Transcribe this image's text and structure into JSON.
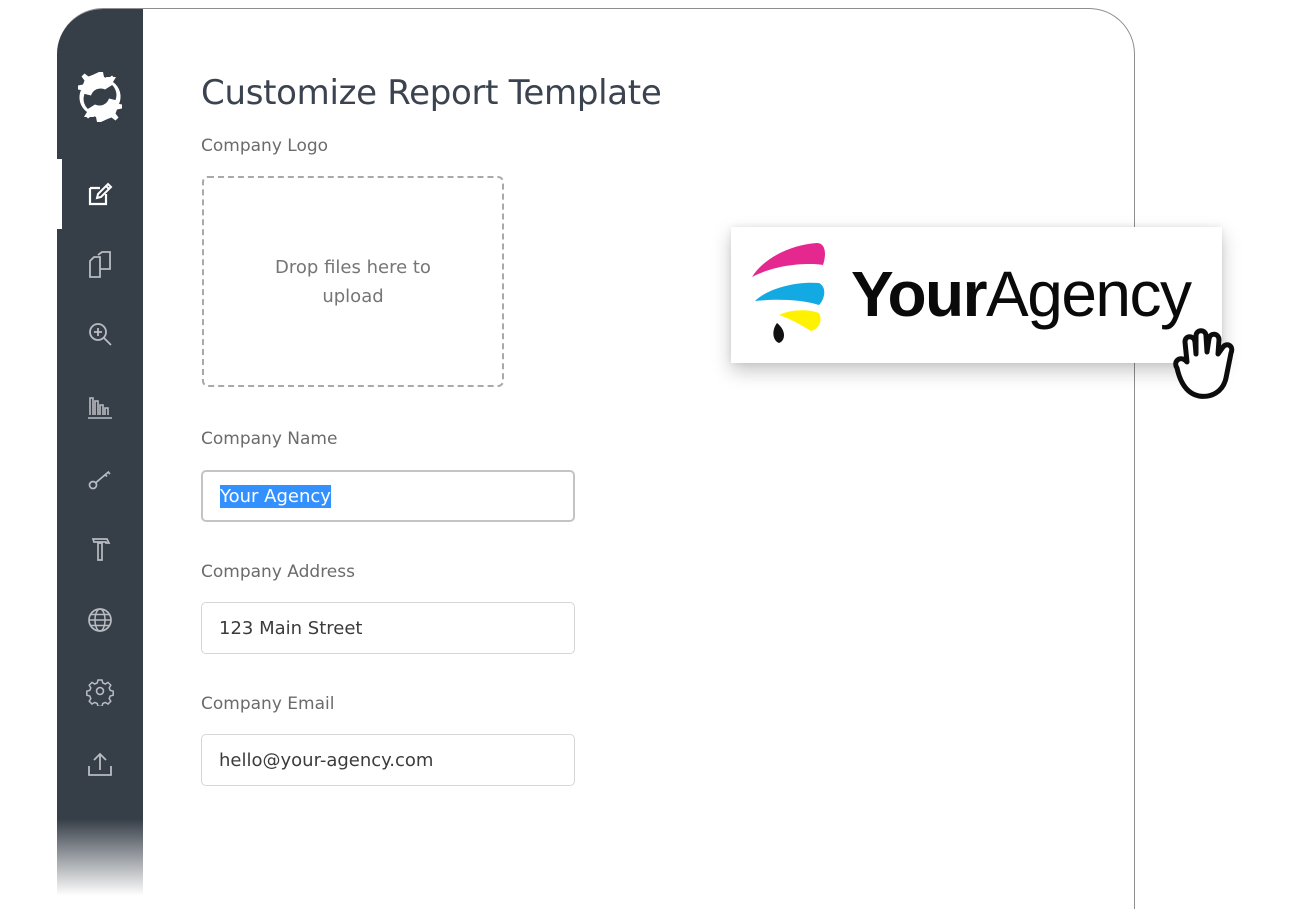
{
  "app": {
    "sidebar": {
      "logo_icon": "gear-sync-icon",
      "items": [
        {
          "id": "edit",
          "icon": "edit-icon",
          "active": true
        },
        {
          "id": "documents",
          "icon": "copy-documents-icon",
          "active": false
        },
        {
          "id": "search",
          "icon": "zoom-in-icon",
          "active": false
        },
        {
          "id": "reports",
          "icon": "bar-chart-icon",
          "active": false
        },
        {
          "id": "keys",
          "icon": "key-icon",
          "active": false
        },
        {
          "id": "tools",
          "icon": "hammer-icon",
          "active": false
        },
        {
          "id": "web",
          "icon": "globe-icon",
          "active": false
        },
        {
          "id": "settings",
          "icon": "gear-icon",
          "active": false
        },
        {
          "id": "export",
          "icon": "upload-icon",
          "active": false
        }
      ]
    },
    "page": {
      "title": "Customize Report Template",
      "logo_field": {
        "label": "Company Logo",
        "dropzone_text": "Drop files here to upload"
      },
      "name_field": {
        "label": "Company Name",
        "value": "Your Agency",
        "selected": true
      },
      "address_field": {
        "label": "Company Address",
        "value": "123 Main Street"
      },
      "email_field": {
        "label": "Company Email",
        "value": "hello@your-agency.com"
      }
    },
    "dragged_logo": {
      "word_bold": "Your",
      "word_regular": "Agency",
      "colors": {
        "magenta": "#e5288f",
        "cyan": "#13a9e3",
        "yellow": "#fff200",
        "black": "#111111"
      },
      "cursor_icon": "grab-hand-icon"
    },
    "colors": {
      "sidebar_bg": "#363e48",
      "selection": "#3391ff",
      "title_text": "#3b4350"
    }
  }
}
